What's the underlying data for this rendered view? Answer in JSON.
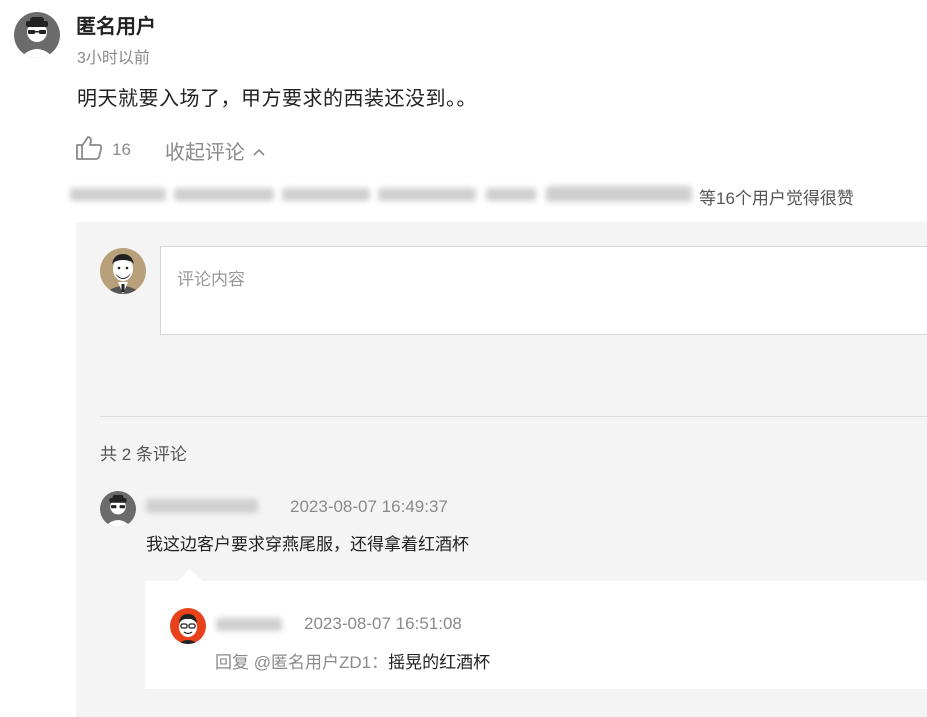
{
  "post": {
    "author": "匿名用户",
    "time": "3小时以前",
    "content": "明天就要入场了，甲方要求的西装还没到。。",
    "like_count": "16",
    "collapse_label": "收起评论",
    "likers_text": "等16个用户觉得很赞"
  },
  "editor": {
    "placeholder": "评论内容"
  },
  "comments": {
    "count_text": "共 2 条评论",
    "items": [
      {
        "time": "2023-08-07 16:49:37",
        "content": "我这边客户要求穿燕尾服，还得拿着红酒杯"
      }
    ],
    "replies": [
      {
        "time": "2023-08-07 16:51:08",
        "reply_prefix": "回复 @匿名用户ZD1：",
        "content": "摇晃的红酒杯"
      }
    ]
  },
  "colors": {
    "reply_avatar": "#e8421c",
    "panel_bg": "#f4f4f4"
  }
}
